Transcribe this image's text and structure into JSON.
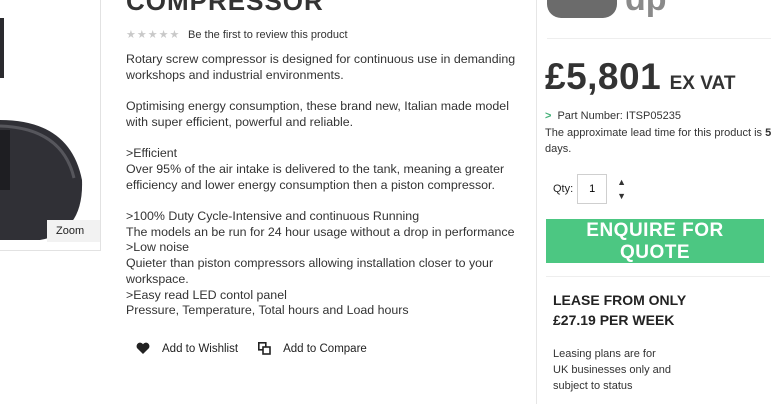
{
  "product": {
    "title": "COMPRESSOR",
    "stars": "★★★★★",
    "review_link": "Be the first to review this product",
    "zoom_label": "Zoom",
    "description": [
      "Rotary screw compressor is designed for continuous use in demanding workshops and industrial environments.",
      "",
      "Optimising energy consumption, these brand new, Italian made model with super efficient, powerful and reliable.",
      "",
      ">Efficient",
      "Over 95% of the air intake is delivered to the tank, meaning a greater efficiency and lower energy consumption then a piston compressor.",
      "",
      ">100% Duty Cycle-Intensive and continuous Running",
      "The models an be run for 24 hour usage without a drop in performance",
      ">Low noise",
      "Quieter than piston compressors allowing installation closer to your workspace.",
      ">Easy read LED contol panel",
      "Pressure, Temperature, Total hours and Load hours"
    ],
    "actions": {
      "wishlist_label": "Add to Wishlist",
      "compare_label": "Add to Compare"
    }
  },
  "sidebar": {
    "logo_fragment": "dp",
    "price": {
      "amount": "£5,801",
      "suffix": "EX VAT"
    },
    "part_number": {
      "arrow": ">",
      "label": "Part Number: ITSP05235"
    },
    "lead_time": {
      "text_before": "The approximate lead time for this product is ",
      "days": "5",
      "text_after": " days."
    },
    "qty": {
      "label": "Qty:",
      "value": "1",
      "up": "▲",
      "down": "▼"
    },
    "enquire_label": "ENQUIRE FOR QUOTE",
    "lease": {
      "line1": "LEASE FROM ONLY",
      "line2": "£27.19 PER WEEK"
    },
    "lease_note": "Leasing plans are for UK businesses only and subject to status"
  },
  "colors": {
    "accent_green": "#4cc782",
    "arrow_green": "#43b077",
    "text": "#333333"
  }
}
